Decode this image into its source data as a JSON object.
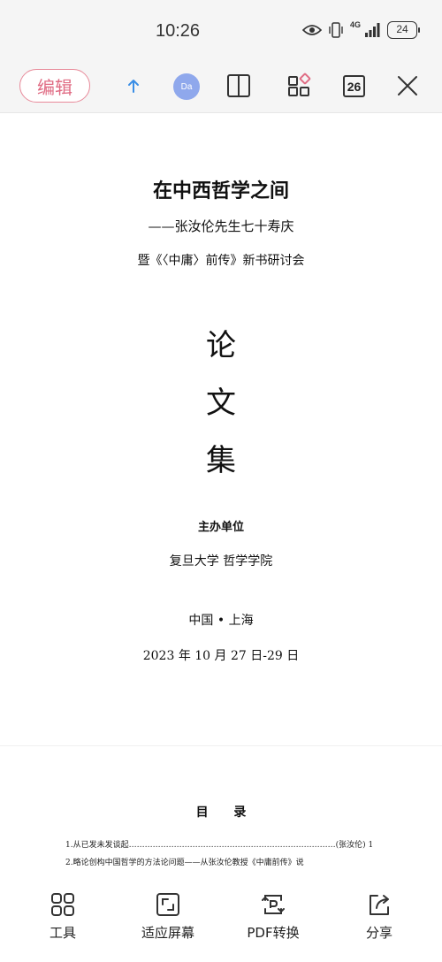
{
  "status_bar": {
    "time": "10:26",
    "network": "4G",
    "battery": "24"
  },
  "toolbar": {
    "edit_label": "编辑",
    "avatar_initials": "Da",
    "page_count": "26",
    "accent_color": "#e06c84"
  },
  "document": {
    "title": "在中西哲学之间",
    "subtitle_line1": "——张汝伦先生七十寿庆",
    "subtitle_line2": "暨《〈中庸〉前传》新书研讨会",
    "big_chars": [
      "论",
      "文",
      "集"
    ],
    "host_label": "主办单位",
    "host": "复旦大学  哲学学院",
    "place": "中国 • 上海",
    "date": "2023 年 10 月 27 日-29 日",
    "toc_title": "目 录",
    "toc_items": [
      "1.从已发未发谈起……………………………………………………………………(张汝伦) 1",
      "2.略论创构中国哲学的方法论问题——从张汝伦教授《中庸前传》说"
    ]
  },
  "bottom_bar": {
    "items": [
      {
        "label": "工具",
        "icon": "tools-grid-icon"
      },
      {
        "label": "适应屏幕",
        "icon": "fit-screen-icon"
      },
      {
        "label": "PDF转换",
        "icon": "pdf-convert-icon"
      },
      {
        "label": "分享",
        "icon": "share-icon"
      }
    ]
  }
}
